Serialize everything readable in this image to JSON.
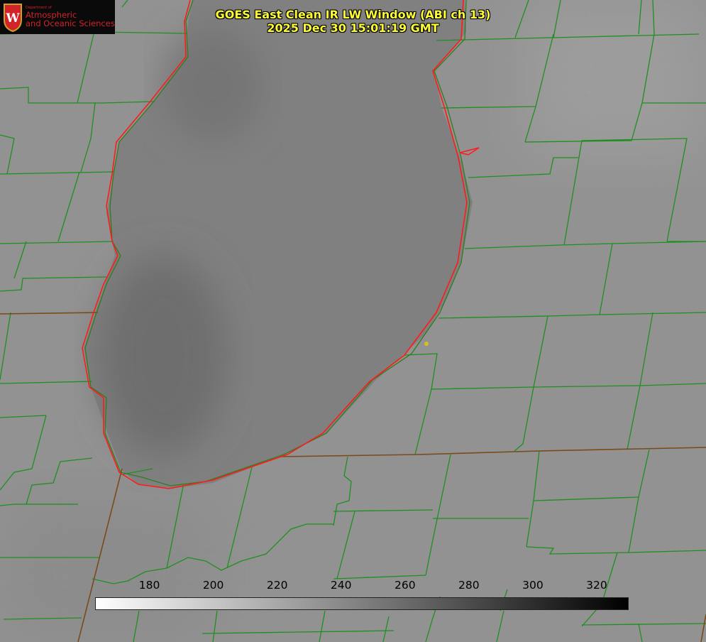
{
  "title": {
    "line1": "GOES East Clean IR LW Window (ABI ch 13)",
    "line2": "2025 Dec 30 15:01:19 GMT"
  },
  "logo": {
    "department": "Department of",
    "line1": "Atmospheric",
    "line2": "and Oceanic Sciences",
    "crest_icon": "uw-crest-icon",
    "brand_color": "#d2232a"
  },
  "colorbar": {
    "ticks": [
      "180",
      "200",
      "220",
      "240",
      "260",
      "280",
      "300",
      "320"
    ],
    "tick_values": [
      180,
      200,
      220,
      240,
      260,
      280,
      300,
      320
    ],
    "range": [
      163,
      330
    ],
    "gradient": [
      "#ffffff",
      "#000000"
    ]
  },
  "colors": {
    "county_lines": "#1f8f1f",
    "shoreline": "#ff1a1a",
    "state_lines": "#7a4a1a",
    "title": "#ffff33",
    "marker": "#d4c21a"
  }
}
